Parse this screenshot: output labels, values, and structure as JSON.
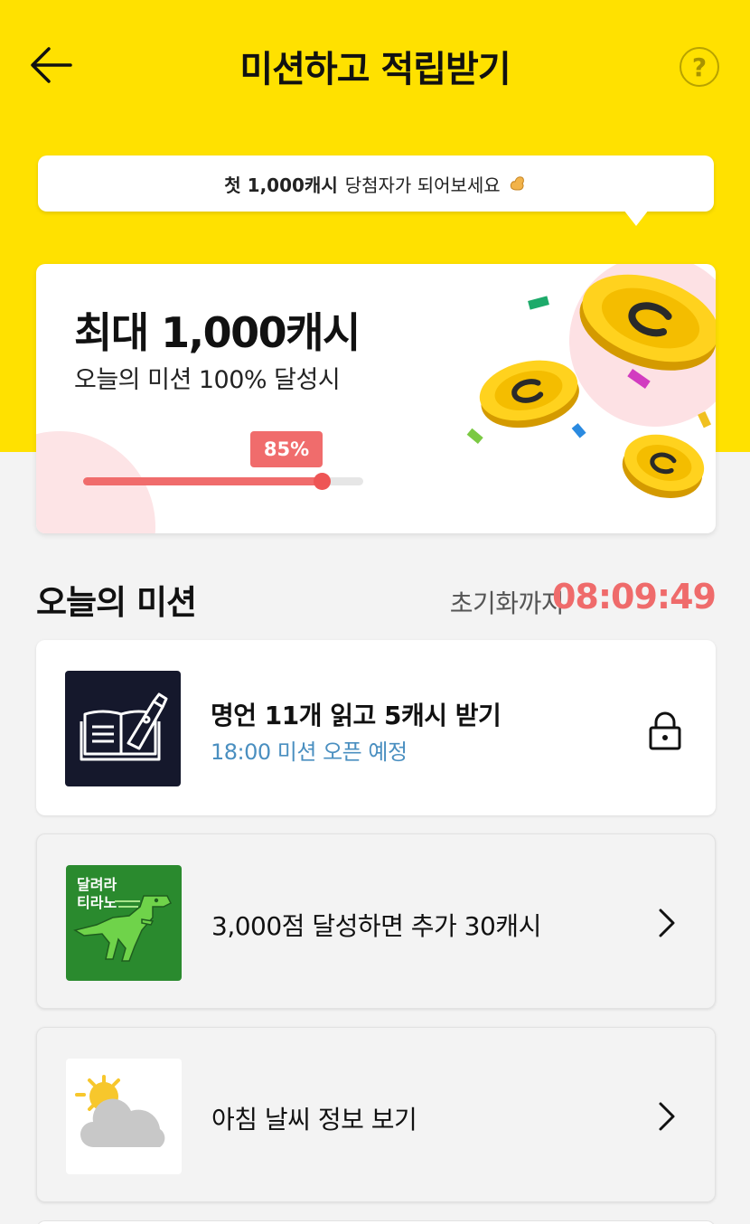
{
  "header": {
    "title": "미션하고 적립받기",
    "back_icon": "arrow-left-icon",
    "help_label": "?"
  },
  "bubble": {
    "bold_text": "첫 1,000캐시",
    "text": "당첨자가 되어보세요",
    "emoji_icon": "flexed-biceps-icon"
  },
  "hero": {
    "title": "최대 1,000캐시",
    "subtitle": "오늘의 미션 100% 달성시",
    "progress_label": "85%",
    "progress_value": 0.85
  },
  "missions_section": {
    "title": "오늘의 미션",
    "reset_label": "초기화까지",
    "reset_timer": "08:09:49"
  },
  "missions": [
    {
      "title": "명언 11개 읽고 5캐시 받기",
      "subtitle": "18:00 미션 오픈 예정",
      "thumb_icon": "book-pen-icon",
      "action_icon": "lock-icon"
    },
    {
      "title": "3,000점 달성하면 추가 30캐시",
      "thumb_text_line1": "달려라",
      "thumb_text_line2": "티라노",
      "thumb_icon": "dinosaur-icon",
      "action_icon": "chevron-right-icon"
    },
    {
      "title": "아침 날씨 정보 보기",
      "thumb_icon": "sun-cloud-icon",
      "action_icon": "chevron-right-icon"
    }
  ],
  "colors": {
    "brand_yellow": "#ffe100",
    "accent_red": "#f06c6c",
    "info_blue": "#4a8fc0"
  }
}
